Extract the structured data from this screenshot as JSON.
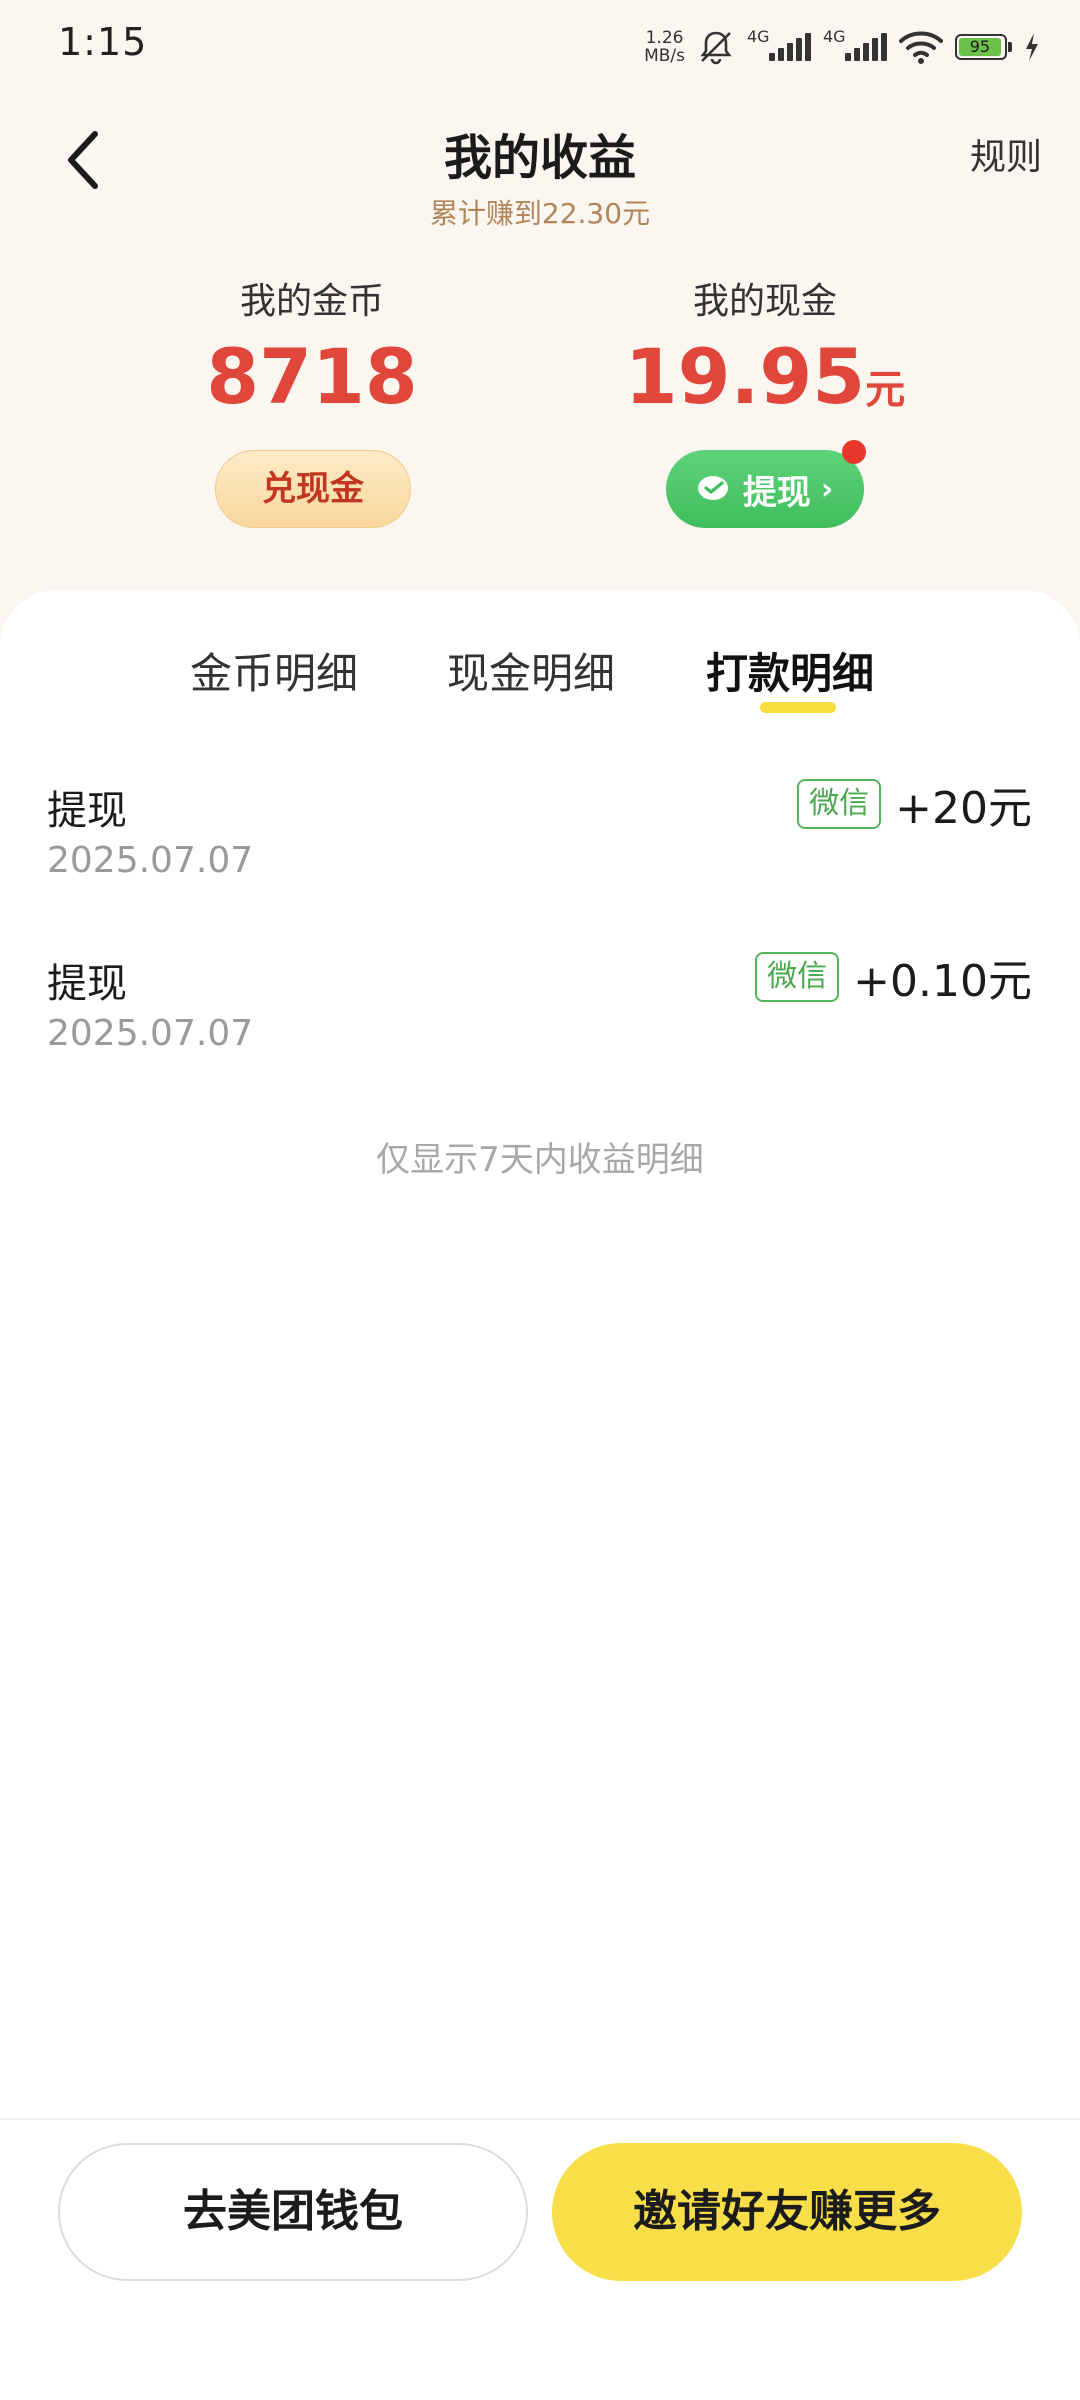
{
  "status_bar": {
    "time": "1:15",
    "net_speed_value": "1.26",
    "net_speed_unit": "MB/s",
    "signal1_label": "4G",
    "signal2_label": "4G",
    "battery": "95",
    "icons": [
      "mute-bell-icon",
      "signal-icon",
      "wifi-icon",
      "battery-icon",
      "charging-icon"
    ]
  },
  "header": {
    "title": "我的收益",
    "subtitle": "累计赚到22.30元",
    "rules_label": "规则"
  },
  "summary": {
    "coins_label": "我的金币",
    "coins_value": "8718",
    "cash_label": "我的现金",
    "cash_value": "19.95",
    "cash_unit": "元",
    "exchange_button": "兑现金",
    "withdraw_button": "提现",
    "withdraw_chevron": "›"
  },
  "tabs": [
    {
      "label": "金币明细"
    },
    {
      "label": "现金明细"
    },
    {
      "label": "打款明细",
      "active": true
    }
  ],
  "records": [
    {
      "title": "提现",
      "date": "2025.07.07",
      "channel": "微信",
      "amount": "+20元"
    },
    {
      "title": "提现",
      "date": "2025.07.07",
      "channel": "微信",
      "amount": "+0.10元"
    }
  ],
  "note": "仅显示7天内收益明细",
  "bottom": {
    "wallet_button": "去美团钱包",
    "invite_button": "邀请好友赚更多"
  },
  "colors": {
    "accent_red": "#e0463a",
    "withdraw_green": "#3fbd5c",
    "invite_yellow": "#f8df49",
    "tag_green": "#4aa84f"
  }
}
